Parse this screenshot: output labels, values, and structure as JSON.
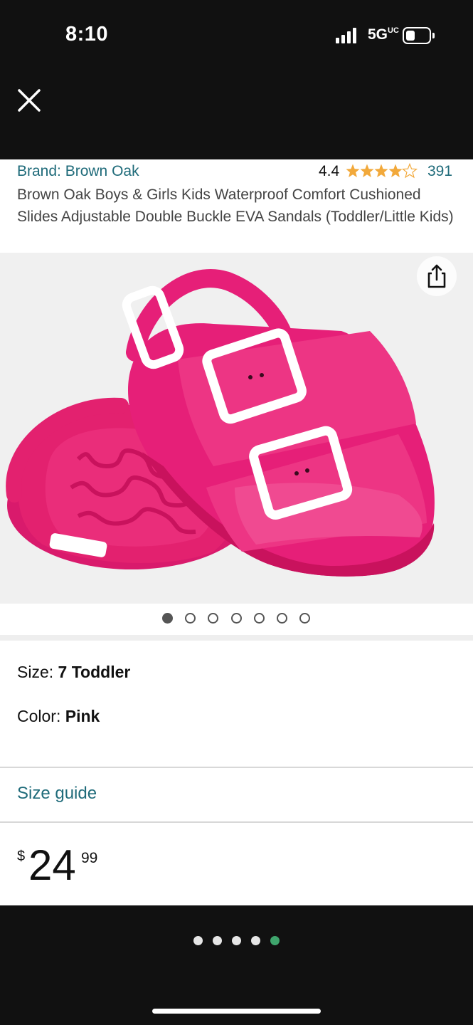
{
  "status_bar": {
    "time": "8:10",
    "network": "5G",
    "network_suffix": "UC"
  },
  "product": {
    "brand": "Brand: Brown Oak",
    "rating": "4.4",
    "rating_stars_value": 4.4,
    "rating_count": "391",
    "title": "Brown Oak Boys & Girls Kids Waterproof Comfort Cushioned Slides Adjustable Double Buckle EVA Sandals (Toddler/Little Kids)",
    "image": {
      "icon": "pink-sandals-photo",
      "color": "#e61f78"
    },
    "image_carousel": {
      "count": 7,
      "active_index": 0
    }
  },
  "variants": {
    "size_label": "Size: ",
    "size_value": "7 Toddler",
    "color_label": "Color: ",
    "color_value": "Pink"
  },
  "size_guide": "Size guide",
  "price": {
    "symbol": "$",
    "whole": "24",
    "fraction": "99"
  },
  "pager": {
    "count": 5,
    "active_index": 4,
    "active_color": "#3fa56d"
  },
  "colors": {
    "link": "#1f6b7a",
    "star": "#f2a93b"
  }
}
